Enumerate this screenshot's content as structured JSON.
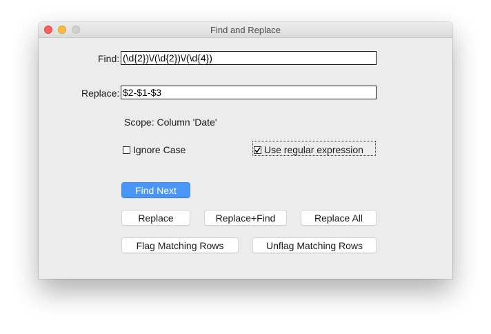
{
  "window": {
    "title": "Find and Replace"
  },
  "find": {
    "label": "Find:",
    "value": "(\\d{2})\\/(\\d{2})\\/(\\d{4})"
  },
  "replace": {
    "label": "Replace:",
    "value": "$2-$1-$3"
  },
  "scope_text": "Scope: Column 'Date'",
  "options": {
    "ignore_case": {
      "label": "Ignore Case",
      "checked": false
    },
    "use_regex": {
      "label": "Use regular expression",
      "checked": true
    }
  },
  "buttons": {
    "find_next": "Find Next",
    "replace": "Replace",
    "replace_find": "Replace+Find",
    "replace_all": "Replace All",
    "flag_rows": "Flag Matching Rows",
    "unflag_rows": "Unflag Matching Rows"
  },
  "colors": {
    "primary_button": "#4a95f8",
    "close": "#fc605c",
    "minimize": "#fdbc40",
    "zoom": "#d0d0d0"
  }
}
